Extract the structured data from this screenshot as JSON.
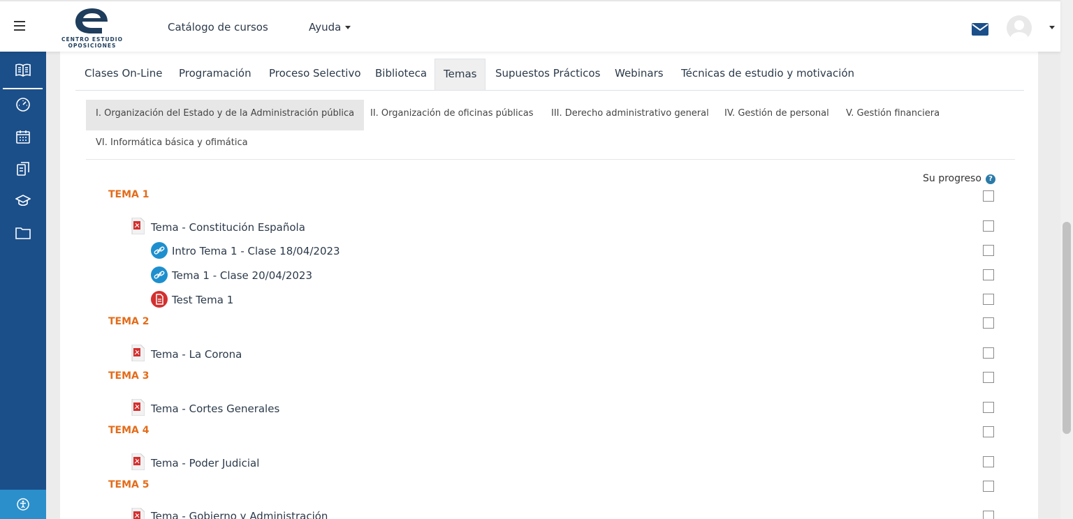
{
  "header": {
    "logo_text_line1": "CENTRO ESTUDIO",
    "logo_text_line2": "OPOSICIONES",
    "nav_catalog": "Catálogo de cursos",
    "nav_help": "Ayuda"
  },
  "main_tabs": [
    {
      "label": "Clases On-Line"
    },
    {
      "label": "Programación"
    },
    {
      "label": "Proceso Selectivo"
    },
    {
      "label": "Biblioteca"
    },
    {
      "label": "Temas",
      "active": true
    },
    {
      "label": "Supuestos Prácticos"
    },
    {
      "label": "Webinars"
    },
    {
      "label": "Técnicas de estudio y motivación"
    }
  ],
  "sub_tabs": [
    {
      "label": "I. Organización del Estado y de la Administración pública",
      "active": true
    },
    {
      "label": "II. Organización de oficinas públicas"
    },
    {
      "label": "III. Derecho administrativo general"
    },
    {
      "label": "IV. Gestión de personal"
    },
    {
      "label": "V. Gestión financiera"
    },
    {
      "label": "VI. Informática básica y ofimática"
    }
  ],
  "progress_label": "Su progreso",
  "help_glyph": "?",
  "sections": [
    {
      "title": "TEMA 1"
    },
    {
      "title": "TEMA 2"
    },
    {
      "title": "TEMA 3"
    },
    {
      "title": "TEMA 4"
    },
    {
      "title": "TEMA 5"
    }
  ],
  "activities": [
    {
      "label": "Tema - Constitución Española",
      "icon": "pdf-icon"
    },
    {
      "label": "Intro Tema 1 - Clase 18/04/2023",
      "icon": "link-icon"
    },
    {
      "label": "Tema 1 - Clase 20/04/2023",
      "icon": "link-icon"
    },
    {
      "label": "Test Tema 1",
      "icon": "quiz-icon"
    },
    {
      "label": "Tema - La Corona",
      "icon": "pdf-icon"
    },
    {
      "label": "Tema - Cortes Generales",
      "icon": "pdf-icon"
    },
    {
      "label": "Tema - Poder Judicial",
      "icon": "pdf-icon"
    },
    {
      "label": "Tema - Gobierno y Administración",
      "icon": "pdf-icon"
    }
  ],
  "colors": {
    "sidebar": "#1b4f8a",
    "section_title": "#e36c1a",
    "link_icon": "#1e8fce",
    "quiz_icon": "#d3302f",
    "accessibility": "#2b8fcb"
  }
}
